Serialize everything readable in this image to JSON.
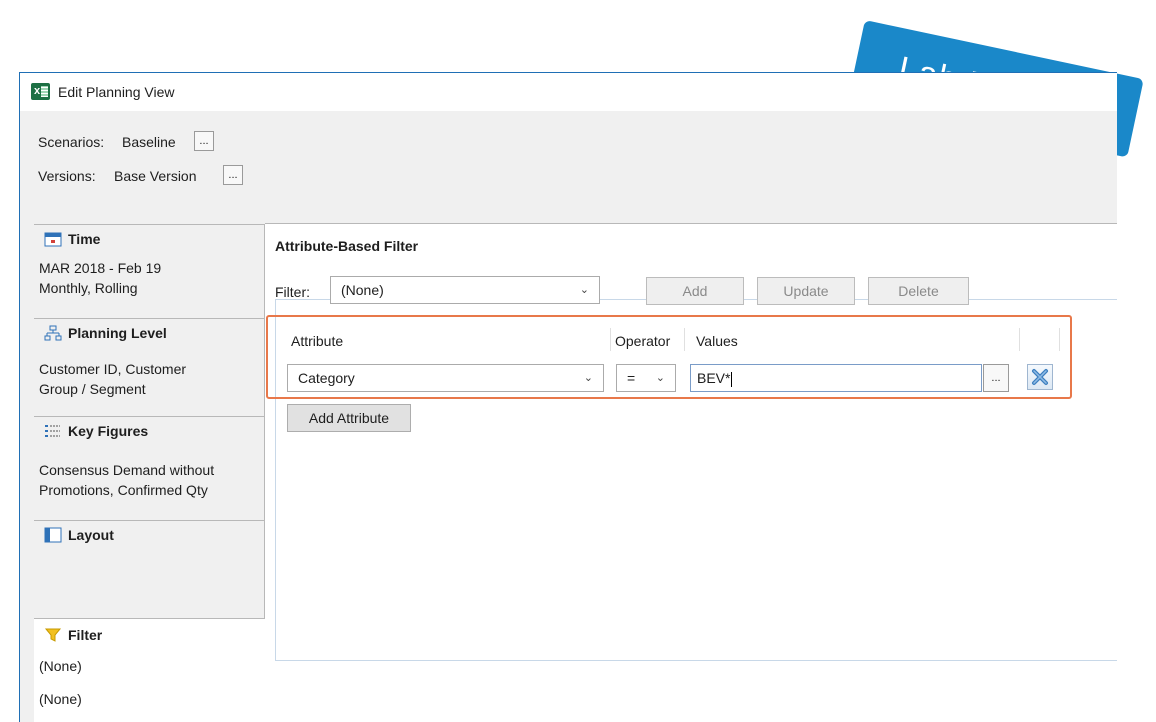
{
  "window": {
    "title": "Edit Planning View"
  },
  "header": {
    "scenarios_label": "Scenarios:",
    "scenarios_value": "Baseline",
    "versions_label": "Versions:",
    "versions_value": "Base Version",
    "ellipsis": "..."
  },
  "left_panel": {
    "time": {
      "title": "Time",
      "line1": "MAR 2018 - Feb 19",
      "line2": "Monthly, Rolling"
    },
    "planning_level": {
      "title": "Planning Level",
      "line1": "Customer ID, Customer",
      "line2": "Group / Segment"
    },
    "key_figures": {
      "title": "Key Figures",
      "line1": "Consensus Demand without",
      "line2": "Promotions, Confirmed Qty"
    },
    "layout": {
      "title": "Layout"
    },
    "filter": {
      "title": "Filter",
      "line1": "(None)",
      "line2": "(None)"
    }
  },
  "main": {
    "heading": "Attribute-Based Filter",
    "filter_label": "Filter:",
    "filter_value": "(None)",
    "add_label": "Add",
    "update_label": "Update",
    "delete_label": "Delete",
    "columns": {
      "attribute": "Attribute",
      "operator": "Operator",
      "values": "Values"
    },
    "row": {
      "attribute": "Category",
      "operator": "=",
      "value": "BEV*"
    },
    "add_attribute_label": "Add Attribute"
  },
  "badge": {
    "text": "Lab Preview"
  },
  "colors": {
    "accent": "#1a88c9",
    "highlight": "#e8784a",
    "excel_green": "#1d7044"
  }
}
